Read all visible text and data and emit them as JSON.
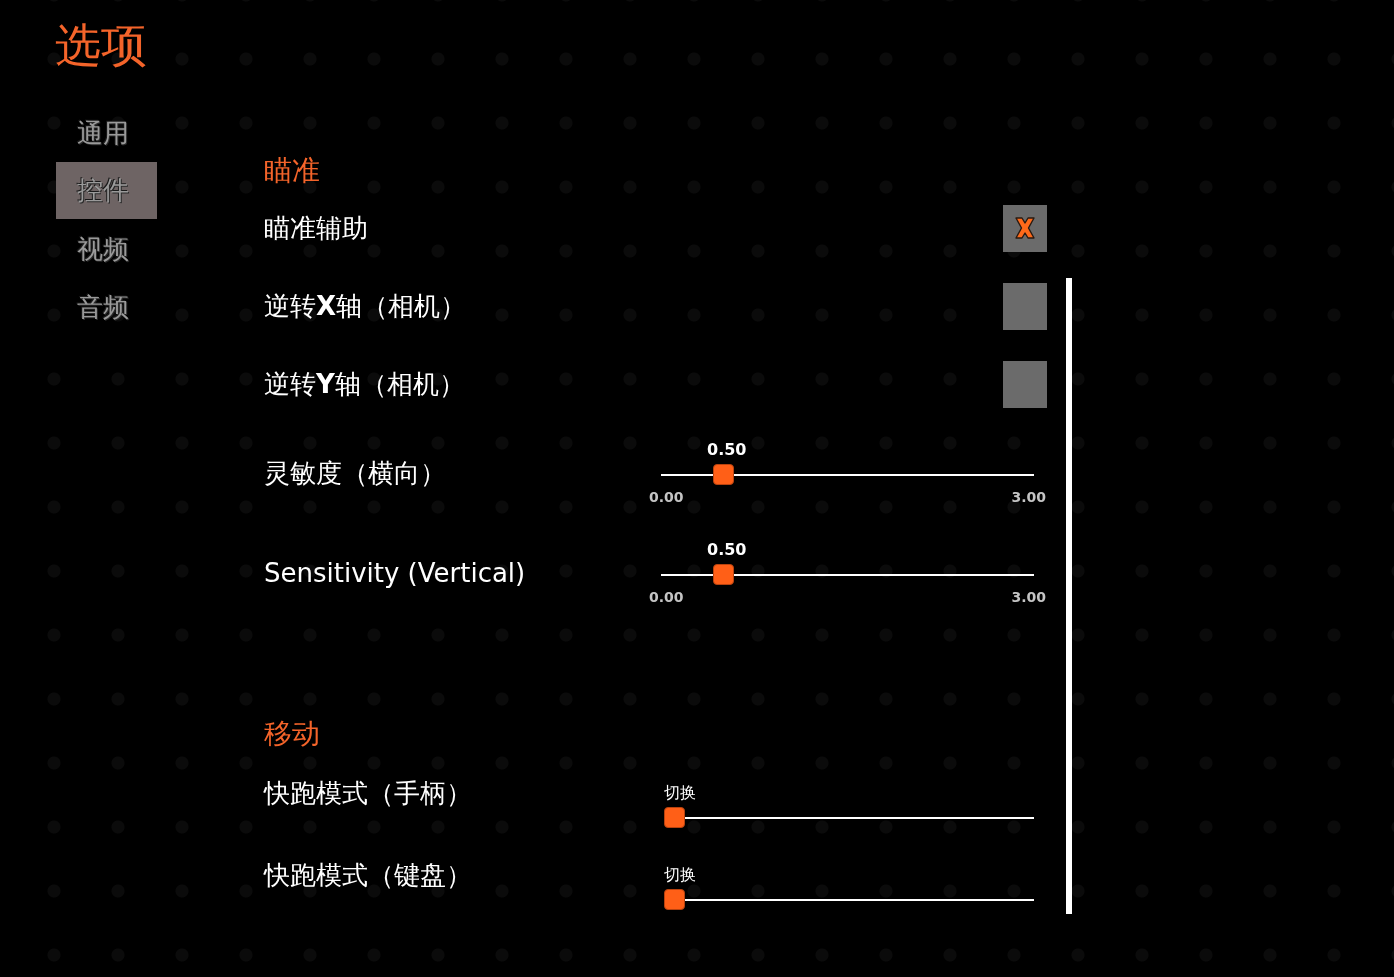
{
  "title": "选项",
  "sidebar": {
    "items": [
      {
        "label": "通用",
        "selected": false
      },
      {
        "label": "控件",
        "selected": true
      },
      {
        "label": "视频",
        "selected": false
      },
      {
        "label": "音频",
        "selected": false
      }
    ]
  },
  "sections": [
    {
      "heading": "瞄准",
      "settings": [
        {
          "kind": "checkbox",
          "label": "瞄准辅助",
          "checked": true
        },
        {
          "kind": "checkbox",
          "label": "逆转**X**轴（相机）",
          "checked": false
        },
        {
          "kind": "checkbox",
          "label": "逆转**Y**轴（相机）",
          "checked": false
        },
        {
          "kind": "slider",
          "label": "灵敏度（横向）",
          "value": "0.50",
          "min": "0.00",
          "max": "3.00",
          "level": 0.167
        },
        {
          "kind": "slider",
          "label": "Sensitivity (Vertical)",
          "value": "0.50",
          "min": "0.00",
          "max": "3.00",
          "level": 0.167
        }
      ]
    },
    {
      "heading": "移动",
      "settings": [
        {
          "kind": "option_slider",
          "label": "快跑模式（手柄）",
          "value": "切换",
          "level": 0
        },
        {
          "kind": "option_slider",
          "label": "快跑模式（键盘）",
          "value": "切换",
          "level": 0
        }
      ]
    }
  ]
}
